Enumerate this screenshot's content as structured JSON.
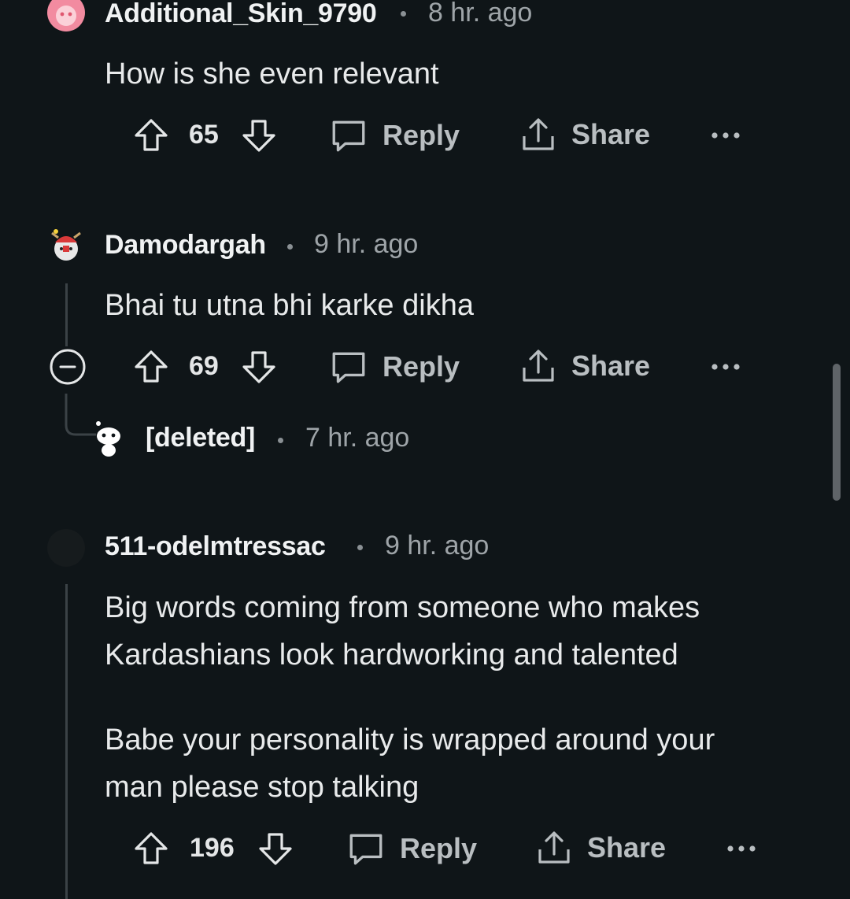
{
  "comments": [
    {
      "username": "Additional_Skin_9790",
      "time": "8 hr. ago",
      "avatar_icon": "pink-snoo-avatar-icon",
      "body": [
        "How is she even relevant"
      ],
      "votes": "65",
      "reply_label": "Reply",
      "share_label": "Share",
      "more_icon": "more-options-icon"
    },
    {
      "username": "Damodargah",
      "time": "9 hr. ago",
      "avatar_icon": "moose-hat-snoo-avatar-icon",
      "body": [
        "Bhai tu utna bhi karke dikha"
      ],
      "votes": "69",
      "reply_label": "Reply",
      "share_label": "Share",
      "collapse_icon": "collapse-minus-icon",
      "more_icon": "more-options-icon"
    },
    {
      "username": "[deleted]",
      "time": "7 hr. ago",
      "avatar_icon": "deleted-snoo-avatar-icon"
    },
    {
      "username": "511-odelmtressac",
      "time": "9 hr. ago",
      "avatar_icon": "dark-avatar-icon",
      "body": [
        "Big words coming from someone who makes",
        "Kardashians look hardworking and talented",
        "",
        "Babe your personality is wrapped around your",
        "man please stop talking"
      ],
      "votes": "196",
      "reply_label": "Reply",
      "share_label": "Share",
      "more_icon": "more-options-icon"
    }
  ],
  "colors": {
    "background": "#0f1518",
    "text": "#e8eaeb",
    "muted": "#9ea4a8",
    "thread_line": "#3b4246"
  }
}
